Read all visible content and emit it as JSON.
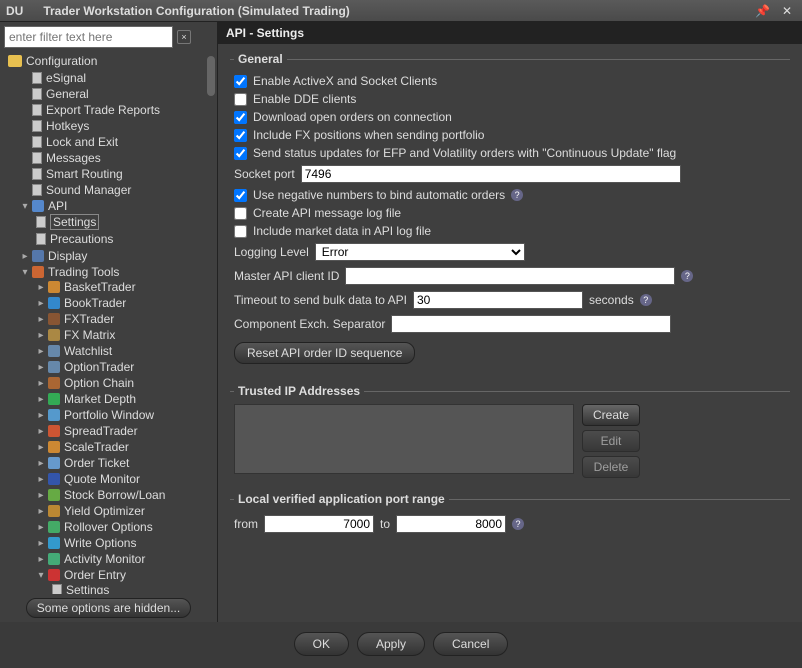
{
  "titlebar": {
    "du": "DU",
    "title": "Trader Workstation Configuration (Simulated Trading)"
  },
  "filter_placeholder": "enter filter text here",
  "tree_root": "Configuration",
  "sidebar": {
    "items": [
      {
        "label": "eSignal"
      },
      {
        "label": "General"
      },
      {
        "label": "Export Trade Reports"
      },
      {
        "label": "Hotkeys"
      },
      {
        "label": "Lock and Exit"
      },
      {
        "label": "Messages"
      },
      {
        "label": "Smart Routing"
      },
      {
        "label": "Sound Manager"
      }
    ],
    "api": {
      "label": "API",
      "children": [
        "Settings",
        "Precautions"
      ]
    },
    "display": {
      "label": "Display"
    },
    "trading": {
      "label": "Trading Tools",
      "children": [
        {
          "label": "BasketTrader",
          "color": "#cc8833"
        },
        {
          "label": "BookTrader",
          "color": "#3388cc"
        },
        {
          "label": "FXTrader",
          "color": "#885533"
        },
        {
          "label": "FX Matrix",
          "color": "#aa8844"
        },
        {
          "label": "Watchlist",
          "color": "#6688aa"
        },
        {
          "label": "OptionTrader",
          "color": "#6688aa"
        },
        {
          "label": "Option Chain",
          "color": "#aa6633"
        },
        {
          "label": "Market Depth",
          "color": "#33aa55"
        },
        {
          "label": "Portfolio Window",
          "color": "#5599cc"
        },
        {
          "label": "SpreadTrader",
          "color": "#cc5533"
        },
        {
          "label": "ScaleTrader",
          "color": "#cc8833"
        },
        {
          "label": "Order Ticket",
          "color": "#6699cc"
        },
        {
          "label": "Quote Monitor",
          "color": "#3355aa"
        },
        {
          "label": "Stock Borrow/Loan",
          "color": "#66aa44"
        },
        {
          "label": "Yield Optimizer",
          "color": "#bb8833"
        },
        {
          "label": "Rollover Options",
          "color": "#44aa66"
        },
        {
          "label": "Write Options",
          "color": "#3399cc"
        },
        {
          "label": "Activity Monitor",
          "color": "#44aa77"
        }
      ],
      "order_entry": {
        "label": "Order Entry",
        "child": "Settings"
      }
    }
  },
  "hidden_btn": "Some options are hidden...",
  "header": "API - Settings",
  "general": {
    "legend": "General",
    "chk": [
      {
        "label": "Enable ActiveX and Socket Clients",
        "checked": true
      },
      {
        "label": "Enable DDE clients",
        "checked": false
      },
      {
        "label": "Download open orders on connection",
        "checked": true
      },
      {
        "label": "Include FX positions when sending portfolio",
        "checked": true
      },
      {
        "label": "Send status updates for EFP and Volatility orders with \"Continuous Update\" flag",
        "checked": true
      }
    ],
    "socket_label": "Socket port",
    "socket_value": "7496",
    "chk2": [
      {
        "label": "Use negative numbers to bind automatic orders",
        "checked": true,
        "help": true
      },
      {
        "label": "Create API message log file",
        "checked": false
      },
      {
        "label": "Include market data in API log file",
        "checked": false
      }
    ],
    "logging_label": "Logging Level",
    "logging_value": "Error",
    "master_label": "Master API client ID",
    "master_value": "",
    "timeout_label": "Timeout to send bulk data to API",
    "timeout_value": "30",
    "timeout_suffix": "seconds",
    "separator_label": "Component Exch. Separator",
    "separator_value": "",
    "reset_btn": "Reset API order ID sequence"
  },
  "trusted": {
    "legend": "Trusted IP Addresses",
    "create": "Create",
    "edit": "Edit",
    "delete": "Delete"
  },
  "portrange": {
    "legend": "Local verified application port range",
    "from_label": "from",
    "from_value": "7000",
    "to_label": "to",
    "to_value": "8000"
  },
  "footer": {
    "ok": "OK",
    "apply": "Apply",
    "cancel": "Cancel"
  }
}
